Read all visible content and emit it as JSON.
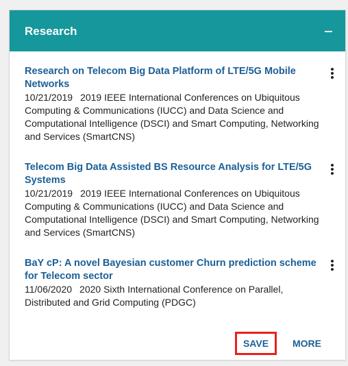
{
  "panel": {
    "title": "Research",
    "collapse_glyph": "minus-icon",
    "header_color": "#15979c",
    "link_color": "#1b5f96"
  },
  "publications": [
    {
      "title": "Research on Telecom Big Data Platform of LTE/5G Mobile Networks",
      "date": "10/21/2019",
      "venue": "2019 IEEE International Conferences on Ubiquitous Computing & Communications (IUCC) and Data Science and Computational Intelligence (DSCI) and Smart Computing, Networking and Services (SmartCNS)"
    },
    {
      "title": "Telecom Big Data Assisted BS Resource Analysis for LTE/5G Systems",
      "date": "10/21/2019",
      "venue": "2019 IEEE International Conferences on Ubiquitous Computing & Communications (IUCC) and Data Science and Computational Intelligence (DSCI) and Smart Computing, Networking and Services (SmartCNS)"
    },
    {
      "title": "BaY cP: A novel Bayesian customer Churn prediction scheme for Telecom sector",
      "date": "11/06/2020",
      "venue": "2020 Sixth International Conference on Parallel, Distributed and Grid Computing (PDGC)"
    }
  ],
  "actions": {
    "save_label": "SAVE",
    "more_label": "MORE",
    "highlight_color": "#e8201d"
  }
}
